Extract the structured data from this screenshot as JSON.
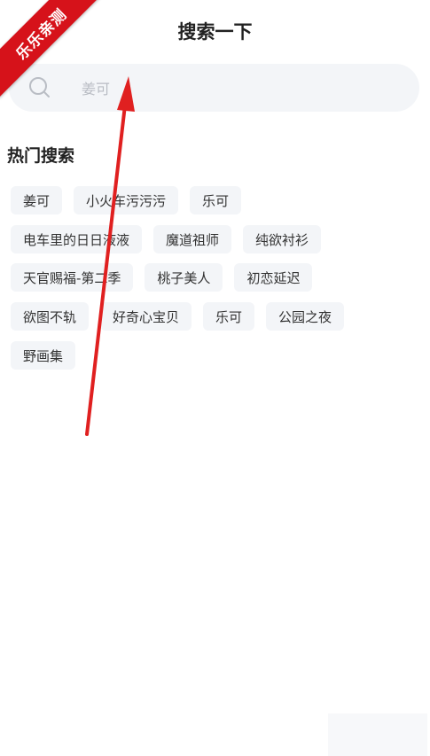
{
  "watermark": {
    "text": "乐乐亲测"
  },
  "header": {
    "title": "搜索一下"
  },
  "search": {
    "placeholder": "姜可",
    "icon": "search-icon"
  },
  "hot": {
    "title": "热门搜索",
    "tags": [
      [
        "姜可",
        "小火车污污污",
        "乐可"
      ],
      [
        "电车里的日日液液",
        "魔道祖师",
        "纯欲衬衫"
      ],
      [
        "天官赐福-第二季",
        "桃子美人",
        "初恋延迟"
      ],
      [
        "欲图不轨",
        "好奇心宝贝",
        "乐可",
        "公园之夜"
      ],
      [
        "野画集"
      ]
    ]
  },
  "colors": {
    "annotation_arrow": "#e02020",
    "ribbon": "#d6121a",
    "chip_bg": "#f3f5f8"
  }
}
